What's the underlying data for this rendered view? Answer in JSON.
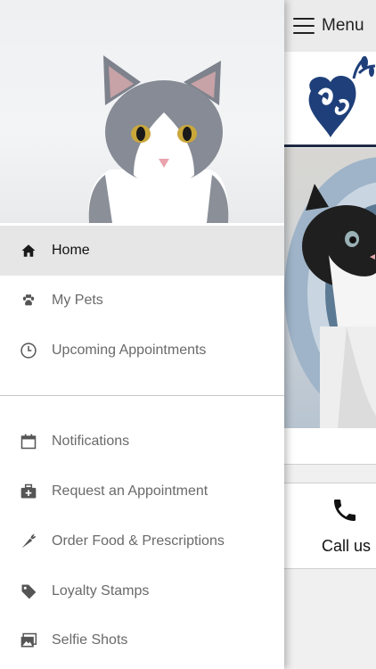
{
  "topbar": {
    "menu_label": "Menu"
  },
  "nav_primary": [
    {
      "label": "Home",
      "icon": "home-icon",
      "active": true
    },
    {
      "label": "My Pets",
      "icon": "paw-icon"
    },
    {
      "label": "Upcoming Appointments",
      "icon": "clock-icon"
    }
  ],
  "nav_secondary": [
    {
      "label": "Notifications",
      "icon": "calendar-icon"
    },
    {
      "label": "Request an Appointment",
      "icon": "medical-kit-icon"
    },
    {
      "label": "Order Food & Prescriptions",
      "icon": "carrot-icon"
    },
    {
      "label": "Loyalty Stamps",
      "icon": "tag-icon"
    },
    {
      "label": "Selfie Shots",
      "icon": "photos-icon"
    }
  ],
  "call_card": {
    "label": "Call us",
    "icon": "phone-icon"
  },
  "colors": {
    "active_bg": "#e6e6e6",
    "logo_blue": "#1f3f7a",
    "text_muted": "#6a6a6a"
  }
}
